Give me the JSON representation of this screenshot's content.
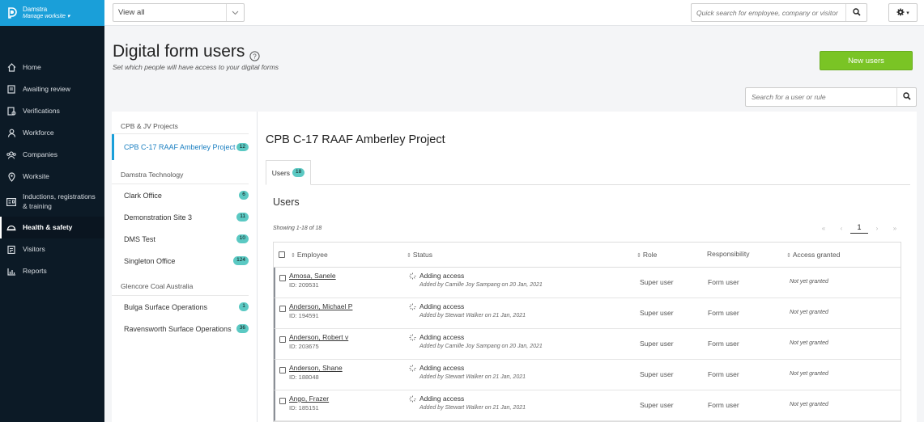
{
  "brand": {
    "name": "Damstra",
    "subtitle": "Manage worksite"
  },
  "nav": [
    {
      "label": "Home",
      "icon": "home-icon"
    },
    {
      "label": "Awaiting review",
      "icon": "document-icon"
    },
    {
      "label": "Verifications",
      "icon": "verify-icon"
    },
    {
      "label": "Workforce",
      "icon": "person-icon"
    },
    {
      "label": "Companies",
      "icon": "people-icon"
    },
    {
      "label": "Worksite",
      "icon": "location-pin-icon"
    },
    {
      "label": "Inductions, registrations & training",
      "icon": "id-card-icon"
    },
    {
      "label": "Health & safety",
      "icon": "hard-hat-icon",
      "active": true
    },
    {
      "label": "Visitors",
      "icon": "clipboard-icon"
    },
    {
      "label": "Reports",
      "icon": "bar-chart-icon"
    }
  ],
  "topbar": {
    "view_select": "View all",
    "quick_search_placeholder": "Quick search for employee, company or visitor"
  },
  "page": {
    "title": "Digital form users",
    "subtitle": "Set which people will have access to your digital forms",
    "new_users_label": "New users",
    "rule_search_placeholder": "Search for a user or rule"
  },
  "groups": [
    {
      "name": "CPB & JV Projects",
      "sites": [
        {
          "name": "CPB C-17 RAAF Amberley Project",
          "count": "12",
          "selected": true
        }
      ]
    },
    {
      "name": "Damstra Technology",
      "sites": [
        {
          "name": "Clark Office",
          "count": "6"
        },
        {
          "name": "Demonstration Site 3",
          "count": "11"
        },
        {
          "name": "DMS Test",
          "count": "10"
        },
        {
          "name": "Singleton Office",
          "count": "124"
        }
      ]
    },
    {
      "name": "Glencore Coal Australia",
      "sites": [
        {
          "name": "Bulga Surface Operations",
          "count": "1"
        },
        {
          "name": "Ravensworth Surface Operations",
          "count": "36"
        }
      ]
    }
  ],
  "project": {
    "title": "CPB C-17 RAAF Amberley Project",
    "tab_label": "Users",
    "tab_count": "18",
    "section_title": "Users",
    "showing": "Showing 1-18 of 18",
    "page": "1"
  },
  "columns": {
    "employee": "Employee",
    "status": "Status",
    "role": "Role",
    "responsibility": "Responsibility",
    "access": "Access granted"
  },
  "rows": [
    {
      "name": "Amosa, Sanele",
      "id": "ID: 209531",
      "status": "Adding access",
      "added_by": "Added by Camille Joy Sampang on 20 Jan, 2021",
      "role": "Super user",
      "responsibility": "Form user",
      "access": "Not yet granted"
    },
    {
      "name": "Anderson, Michael P",
      "id": "ID: 194591",
      "status": "Adding access",
      "added_by": "Added by Stewart Walker on 21 Jan, 2021",
      "role": "Super user",
      "responsibility": "Form user",
      "access": "Not yet granted"
    },
    {
      "name": "Anderson, Robert v",
      "id": "ID: 203675",
      "status": "Adding access",
      "added_by": "Added by Camille Joy Sampang on 20 Jan, 2021",
      "role": "Super user",
      "responsibility": "Form user",
      "access": "Not yet granted"
    },
    {
      "name": "Anderson, Shane",
      "id": "ID: 188048",
      "status": "Adding access",
      "added_by": "Added by Stewart Walker on 21 Jan, 2021",
      "role": "Super user",
      "responsibility": "Form user",
      "access": "Not yet granted"
    },
    {
      "name": "Ango, Frazer",
      "id": "ID: 185151",
      "status": "Adding access",
      "added_by": "Added by Stewart Walker on 21 Jan, 2021",
      "role": "Super user",
      "responsibility": "Form user",
      "access": "Not yet granted"
    }
  ],
  "colors": {
    "brand": "#1a9fd9",
    "sidebar": "#0c1a26",
    "primary_button": "#7ac425",
    "badge": "#5bc9c3"
  }
}
